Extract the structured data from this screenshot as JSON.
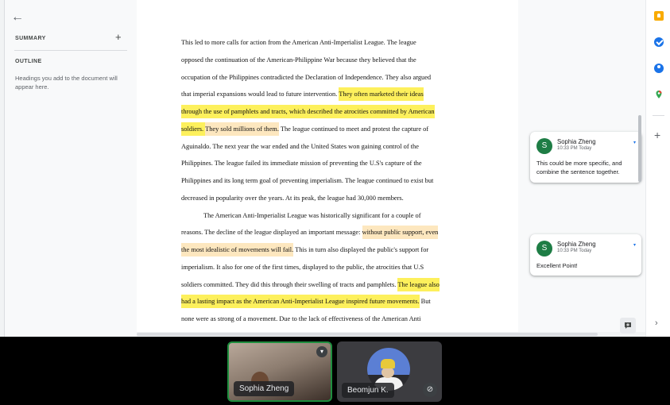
{
  "left_panel": {
    "back_icon": "arrow-left-icon",
    "summary_heading": "SUMMARY",
    "add_icon": "+",
    "outline_heading": "OUTLINE",
    "outline_hint": "Headings you add to the document will appear here."
  },
  "document": {
    "line1": "This led to more calls for action from the American Anti-Imperialist League. The league",
    "line2": "opposed the continuation of the American-Philippine War because they believed that the",
    "line3": "occupation of the Philippines contradicted the Declaration of Independence. They also argued",
    "line4_a": "that imperial expansions would lead to future intervention. ",
    "line4_b": "They often marketed their ideas",
    "line5": "through the use of pamphlets and tracts, which described the atrocities committed by American",
    "line6_a": "soldiers. ",
    "line6_b": "They sold millions of them.",
    "line6_c": " The league continued to meet and protest the capture of",
    "line7": "Aguinaldo. The next year the war ended and the United States won gaining control of the",
    "line8": "Philippines. The league failed its immediate mission of preventing the U.S's capture of the",
    "line9": "Philippines and its long term goal of preventing imperialism. The league continued to exist but",
    "line10": "decreased in popularity over the years. At its peak, the league had 30,000 members.",
    "line11": "The American Anti-Imperialist League was historically significant for a couple of",
    "line12_a": "reasons. The decline of the league displayed an important message: ",
    "line12_b": "without public support, even",
    "line13_a": "the most idealistic of movements will fail.",
    "line13_b": " This in turn also displayed the public's support for",
    "line14": "imperialism. It also for one of the first times, displayed to the public, the atrocities that U.S",
    "line15_a": "soldiers committed. They did this through their swelling of tracts and pamphlets. ",
    "line15_b": "The league also",
    "line16_a": "had a lasting impact as the American Anti-Imperialist League inspired future movements.",
    "line16_b": " But",
    "line17": "none were as strong of a movement. Due to the lack of effectiveness of the American Anti"
  },
  "comments": [
    {
      "avatar_letter": "S",
      "author": "Sophia Zheng",
      "time": "10:33 PM Today",
      "body": "This could be more specific, and combine the sentence together."
    },
    {
      "avatar_letter": "S",
      "author": "Sophia Zheng",
      "time": "10:33 PM Today",
      "body": "Excellent Point!"
    }
  ],
  "side_rail": {
    "icons": [
      "keep-icon",
      "tasks-icon",
      "contacts-icon",
      "maps-icon"
    ],
    "add_label": "+",
    "expand_label": "›"
  },
  "video": {
    "participants": [
      {
        "name": "Sophia Zheng",
        "speaking": true
      },
      {
        "name": "Beomjun K.",
        "muted": true
      }
    ]
  },
  "colors": {
    "highlight_yellow": "#fdf05c",
    "highlight_peach": "#fde7bf",
    "avatar_green": "#1e7d45",
    "active_tile_border": "#1e8e3e"
  }
}
